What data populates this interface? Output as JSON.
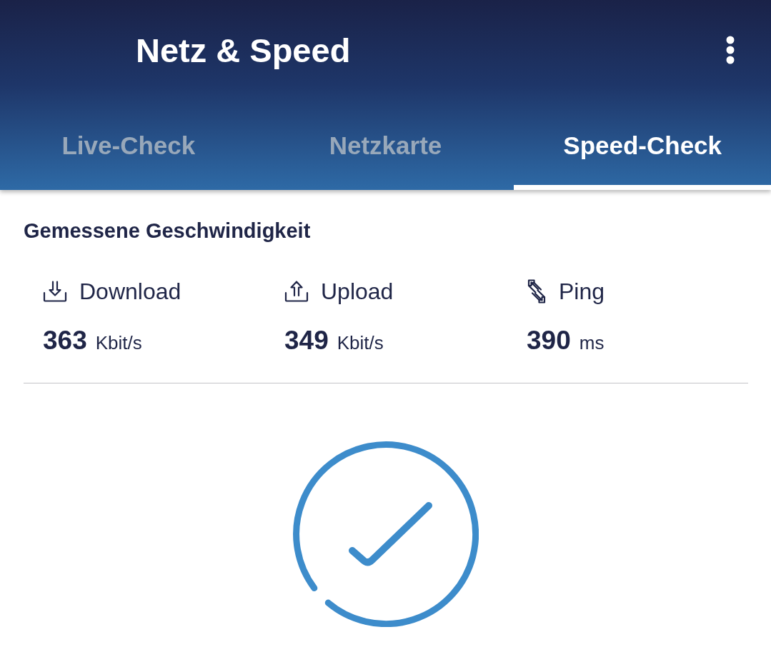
{
  "app_bar": {
    "title": "Netz & Speed"
  },
  "tabs": [
    {
      "label": "Live-Check",
      "selected": false
    },
    {
      "label": "Netzkarte",
      "selected": false
    },
    {
      "label": "Speed-Check",
      "selected": true
    }
  ],
  "results": {
    "title": "Gemessene Geschwindigkeit",
    "metrics": [
      {
        "kind": "download",
        "label": "Download",
        "value": "363",
        "unit": "Kbit/s"
      },
      {
        "kind": "upload",
        "label": "Upload",
        "value": "349",
        "unit": "Kbit/s"
      },
      {
        "kind": "ping",
        "label": "Ping",
        "value": "390",
        "unit": "ms"
      }
    ]
  }
}
